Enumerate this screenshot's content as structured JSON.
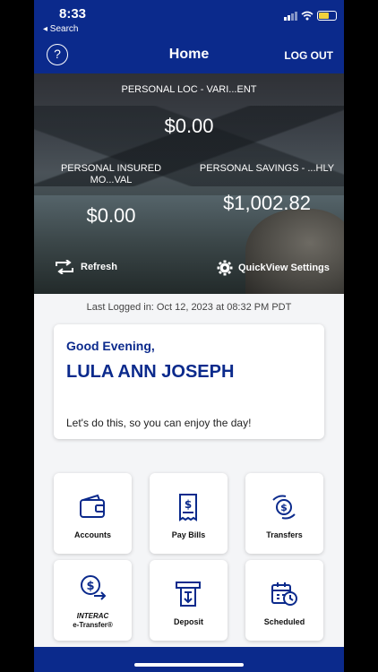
{
  "status_bar": {
    "time": "8:33",
    "back_label": "◂ Search"
  },
  "nav": {
    "help_glyph": "?",
    "title": "Home",
    "logout_label": "LOG OUT"
  },
  "accounts": [
    {
      "name": "PERSONAL LOC - VARI...ENT",
      "balance": "$0.00"
    },
    {
      "name": "PERSONAL INSURED MO...VAL",
      "balance": "$0.00"
    },
    {
      "name": "PERSONAL SAVINGS - ...HLY",
      "balance": "$1,002.82"
    }
  ],
  "hero_actions": {
    "refresh_label": "Refresh",
    "settings_label": "QuickView Settings"
  },
  "last_logged": "Last Logged in: Oct 12, 2023 at 08:32 PM  PDT",
  "greeting": {
    "salutation": "Good Evening,",
    "user_name": "LULA ANN JOSEPH",
    "message": "Let's do this, so you can enjoy the day!"
  },
  "tiles": {
    "accounts": "Accounts",
    "pay_bills": "Pay Bills",
    "transfers": "Transfers",
    "interac_brand": "INTERAC",
    "interac_sub": "e-Transfer®",
    "deposit": "Deposit",
    "scheduled": "Scheduled"
  },
  "colors": {
    "brand_navy": "#0b2a8c",
    "background": "#f4f5f7",
    "battery": "#f2d13b"
  },
  "icons": [
    "help-icon",
    "refresh-icon",
    "gear-icon",
    "wallet-icon",
    "bill-icon",
    "transfer-icon",
    "etransfer-icon",
    "deposit-icon",
    "calendar-clock-icon"
  ]
}
